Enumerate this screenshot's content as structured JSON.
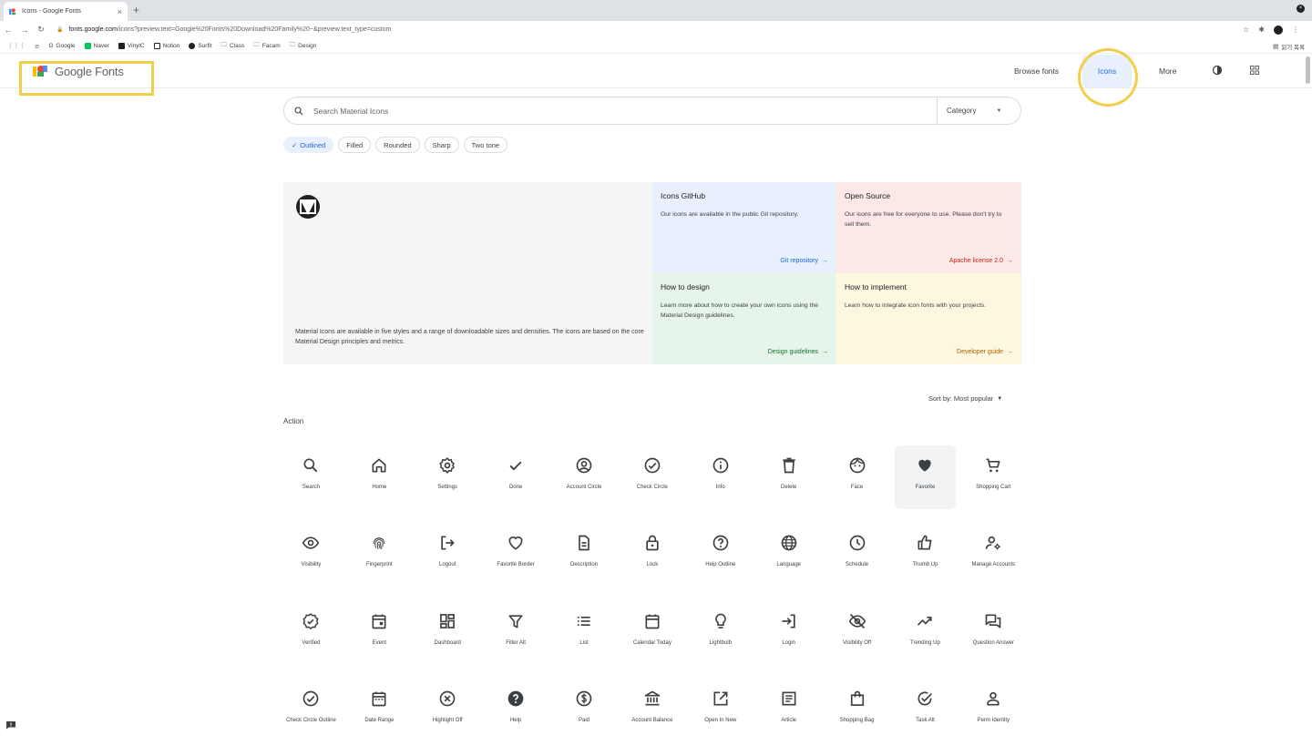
{
  "browser": {
    "tab_title": "Icons - Google Fonts",
    "tab_close": "×",
    "new_tab": "+",
    "url_host": "fonts.google.com",
    "url_path": "/icons?preview.text=Google%20Fonts%20Download%20Family%20~&preview.text_type=custom",
    "bookmarks": [
      "Google",
      "Naver",
      "VinylC",
      "Notion",
      "Surfit",
      "Class",
      "Facam",
      "Design"
    ],
    "bookmark_right": "읽기 목록"
  },
  "header": {
    "brand": "Google Fonts",
    "nav": {
      "browse": "Browse fonts",
      "icons": "Icons",
      "more": "More"
    }
  },
  "search": {
    "placeholder": "Search Material Icons",
    "category_label": "Category",
    "caret": "▼"
  },
  "styles": [
    {
      "label": "Outlined",
      "active": true
    },
    {
      "label": "Filled",
      "active": false
    },
    {
      "label": "Rounded",
      "active": false
    },
    {
      "label": "Sharp",
      "active": false
    },
    {
      "label": "Two tone",
      "active": false
    }
  ],
  "banner": {
    "description": "Material Icons are available in five styles and a range of downloadable sizes and densities. The icons are based on the core Material Design principles and metrics.",
    "cards": [
      {
        "title": "Icons GitHub",
        "text": "Our icons are available in the public Git repository.",
        "link": "Git repository"
      },
      {
        "title": "Open Source",
        "text": "Our icons are free for everyone to use. Please don't try to sell them.",
        "link": "Apache license 2.0"
      },
      {
        "title": "How to design",
        "text": "Learn more about how to create your own icons using the Material Design guidelines.",
        "link": "Design guidelines"
      },
      {
        "title": "How to implement",
        "text": "Learn how to integrate icon fonts with your projects.",
        "link": "Developer guide"
      }
    ],
    "arrow": "→"
  },
  "sort": {
    "label": "Sort by: Most popular",
    "caret": "▼"
  },
  "section": "Action",
  "icons": [
    {
      "name": "Search",
      "icon": "search"
    },
    {
      "name": "Home",
      "icon": "home"
    },
    {
      "name": "Settings",
      "icon": "settings"
    },
    {
      "name": "Done",
      "icon": "done"
    },
    {
      "name": "Account Circle",
      "icon": "account_circle"
    },
    {
      "name": "Check Circle",
      "icon": "check_circle"
    },
    {
      "name": "Info",
      "icon": "info"
    },
    {
      "name": "Delete",
      "icon": "delete"
    },
    {
      "name": "Face",
      "icon": "face"
    },
    {
      "name": "Favorite",
      "icon": "favorite"
    },
    {
      "name": "Shopping Cart",
      "icon": "shopping_cart"
    },
    {
      "name": "Visibility",
      "icon": "visibility"
    },
    {
      "name": "Fingerprint",
      "icon": "fingerprint"
    },
    {
      "name": "Logout",
      "icon": "logout"
    },
    {
      "name": "Favorite Border",
      "icon": "favorite_border"
    },
    {
      "name": "Description",
      "icon": "description"
    },
    {
      "name": "Lock",
      "icon": "lock"
    },
    {
      "name": "Help Outline",
      "icon": "help_outline"
    },
    {
      "name": "Language",
      "icon": "language"
    },
    {
      "name": "Schedule",
      "icon": "schedule"
    },
    {
      "name": "Thumb Up",
      "icon": "thumb_up"
    },
    {
      "name": "Manage Accounts",
      "icon": "manage_accounts"
    },
    {
      "name": "Verified",
      "icon": "verified"
    },
    {
      "name": "Event",
      "icon": "event"
    },
    {
      "name": "Dashboard",
      "icon": "dashboard"
    },
    {
      "name": "Filter Alt",
      "icon": "filter_alt"
    },
    {
      "name": "List",
      "icon": "list"
    },
    {
      "name": "Calendar Today",
      "icon": "calendar_today"
    },
    {
      "name": "Lightbulb",
      "icon": "lightbulb"
    },
    {
      "name": "Login",
      "icon": "login"
    },
    {
      "name": "Visibility Off",
      "icon": "visibility_off"
    },
    {
      "name": "Trending Up",
      "icon": "trending_up"
    },
    {
      "name": "Question Answer",
      "icon": "question_answer"
    },
    {
      "name": "Check Circle Outline",
      "icon": "check_circle_outline"
    },
    {
      "name": "Date Range",
      "icon": "date_range"
    },
    {
      "name": "Highlight Off",
      "icon": "highlight_off"
    },
    {
      "name": "Help",
      "icon": "help"
    },
    {
      "name": "Paid",
      "icon": "paid"
    },
    {
      "name": "Account Balance",
      "icon": "account_balance"
    },
    {
      "name": "Open In New",
      "icon": "open_in_new"
    },
    {
      "name": "Article",
      "icon": "article"
    },
    {
      "name": "Shopping Bag",
      "icon": "shopping_bag"
    },
    {
      "name": "Task Alt",
      "icon": "task_alt"
    },
    {
      "name": "Perm Identity",
      "icon": "perm_identity"
    }
  ],
  "colors": {
    "accent": "#1a73e8",
    "highlight": "#f2cf4a",
    "text": "#3c4043"
  }
}
